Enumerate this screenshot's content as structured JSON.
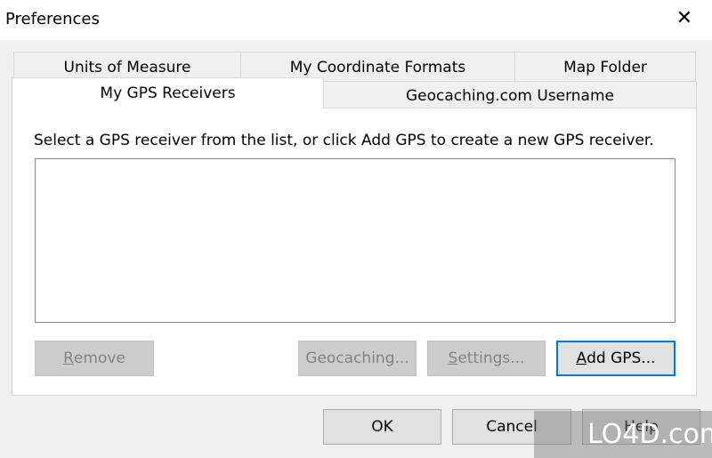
{
  "window": {
    "title": "Preferences",
    "close_icon": "close-icon"
  },
  "tabs": {
    "row1": [
      {
        "label": "Units of Measure"
      },
      {
        "label": "My Coordinate Formats"
      },
      {
        "label": "Map Folder"
      }
    ],
    "row2": [
      {
        "label": "My GPS Receivers",
        "active": true
      },
      {
        "label": "Geocaching.com Username"
      }
    ]
  },
  "panel": {
    "instruction": "Select a GPS receiver from the list, or click Add GPS to create a new GPS receiver.",
    "receivers": []
  },
  "buttons": {
    "remove": {
      "pre": "",
      "key": "R",
      "post": "emove",
      "enabled": false
    },
    "geocaching": {
      "label": "Geocaching...",
      "enabled": false
    },
    "settings": {
      "pre": "",
      "key": "S",
      "post": "ettings...",
      "enabled": false
    },
    "add_gps": {
      "pre": "",
      "key": "A",
      "post": "dd GPS...",
      "enabled": true
    },
    "ok": "OK",
    "cancel": "Cancel",
    "help": "Help"
  },
  "watermark": "LO4D.com",
  "colors": {
    "focus": "#0078d7",
    "background": "#f0f0f0"
  }
}
